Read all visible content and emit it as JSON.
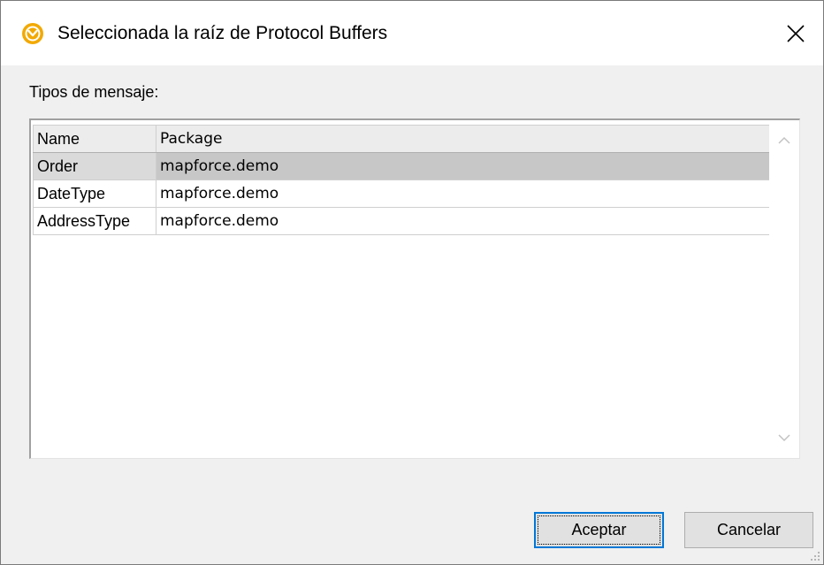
{
  "window": {
    "title": "Seleccionada la raíz de Protocol Buffers",
    "app_icon": "altova-mapforce-icon",
    "close_icon": "close-icon"
  },
  "label": "Tipos de mensaje:",
  "table": {
    "columns": [
      "Name",
      "Package"
    ],
    "rows": [
      {
        "name": "Order",
        "package": "mapforce.demo",
        "selected": true
      },
      {
        "name": "DateType",
        "package": "mapforce.demo",
        "selected": false
      },
      {
        "name": "AddressType",
        "package": "mapforce.demo",
        "selected": false
      }
    ]
  },
  "buttons": {
    "ok": "Aceptar",
    "cancel": "Cancelar"
  },
  "colors": {
    "accent_border": "#0078d7",
    "selection": "#c7c7c7",
    "icon": "#f2a900"
  }
}
